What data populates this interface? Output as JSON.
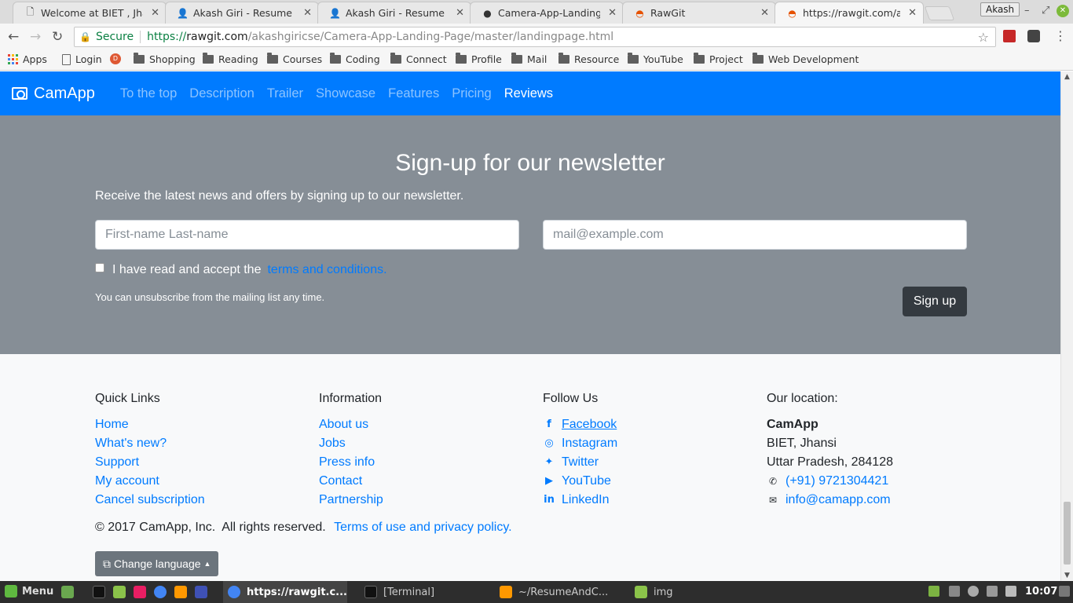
{
  "browser": {
    "tabs": [
      {
        "title": "Welcome at BIET , Jhansi",
        "icon": "page-icon"
      },
      {
        "title": "Akash Giri - Resume and",
        "icon": "person-icon"
      },
      {
        "title": "Akash Giri - Resume and",
        "icon": "person-icon"
      },
      {
        "title": "Camera-App-Landing-P",
        "icon": "github-icon"
      },
      {
        "title": "RawGit",
        "icon": "rawgit-icon"
      },
      {
        "title": "https://rawgit.com/akas",
        "icon": "rawgit-icon"
      }
    ],
    "active_tab_index": 5,
    "profile": "Akash",
    "secure_label": "Secure",
    "url_scheme": "https://",
    "url_host": "rawgit.com",
    "url_path": "/akashgiricse/Camera-App-Landing-Page/master/landingpage.html",
    "bookmarks": [
      {
        "label": "Apps",
        "icon": "apps-icon"
      },
      {
        "label": "Login",
        "icon": "page-icon"
      },
      {
        "label": "Shopping",
        "icon": "folder-icon"
      },
      {
        "label": "Reading",
        "icon": "folder-icon"
      },
      {
        "label": "Courses",
        "icon": "folder-icon"
      },
      {
        "label": "Coding",
        "icon": "folder-icon"
      },
      {
        "label": "Connect",
        "icon": "folder-icon"
      },
      {
        "label": "Profile",
        "icon": "folder-icon"
      },
      {
        "label": "Mail",
        "icon": "folder-icon"
      },
      {
        "label": "Resource",
        "icon": "folder-icon"
      },
      {
        "label": "YouTube",
        "icon": "folder-icon"
      },
      {
        "label": "Project",
        "icon": "folder-icon"
      },
      {
        "label": "Web Development",
        "icon": "folder-icon"
      }
    ]
  },
  "site": {
    "brand": "CamApp",
    "nav": [
      "To the top",
      "Description",
      "Trailer",
      "Showcase",
      "Features",
      "Pricing",
      "Reviews"
    ],
    "nav_active": "Reviews",
    "newsletter": {
      "title": "Sign-up for our newsletter",
      "description": "Receive the latest news and offers by signing up to our newsletter.",
      "name_placeholder": "First-name Last-name",
      "email_placeholder": "mail@example.com",
      "accept_text": "I have read and accept the",
      "terms_link": "terms and conditions.",
      "unsubscribe_note": "You can unsubscribe from the mailing list any time.",
      "signup_button": "Sign up"
    },
    "footer": {
      "quick_links": {
        "heading": "Quick Links",
        "items": [
          "Home",
          "What's new?",
          "Support",
          "My account",
          "Cancel subscription"
        ]
      },
      "information": {
        "heading": "Information",
        "items": [
          "About us",
          "Jobs",
          "Press info",
          "Contact",
          "Partnership"
        ]
      },
      "follow_us": {
        "heading": "Follow Us",
        "items": [
          {
            "label": "Facebook",
            "icon": "facebook-icon"
          },
          {
            "label": "Instagram",
            "icon": "instagram-icon"
          },
          {
            "label": "Twitter",
            "icon": "twitter-icon"
          },
          {
            "label": "YouTube",
            "icon": "youtube-icon"
          },
          {
            "label": "LinkedIn",
            "icon": "linkedin-icon"
          }
        ]
      },
      "location": {
        "heading": "Our location:",
        "company": "CamApp",
        "line1": "BIET, Jhansi",
        "line2": "Uttar Pradesh, 284128",
        "phone": "(+91) 9721304421",
        "email": "info@camapp.com"
      },
      "copyright": "© 2017 CamApp, Inc.  All rights reserved.",
      "terms_link": "Terms of use and privacy policy.",
      "language_button": "Change language"
    }
  },
  "taskbar": {
    "menu_label": "Menu",
    "tasks": [
      {
        "label": "https://rawgit.c...",
        "icon": "chrome-icon",
        "active": true
      },
      {
        "label": "[Terminal]",
        "icon": "terminal-icon",
        "active": false
      },
      {
        "label": "~/ResumeAndC...",
        "icon": "sublime-icon",
        "active": false
      },
      {
        "label": "img",
        "icon": "folder-icon",
        "active": false
      }
    ],
    "clock": "10:07"
  },
  "colors": {
    "primary": "#007bff",
    "newsletter_bg": "#868e96",
    "dark_button": "#343a40",
    "footer_bg": "#f8f9fa"
  }
}
